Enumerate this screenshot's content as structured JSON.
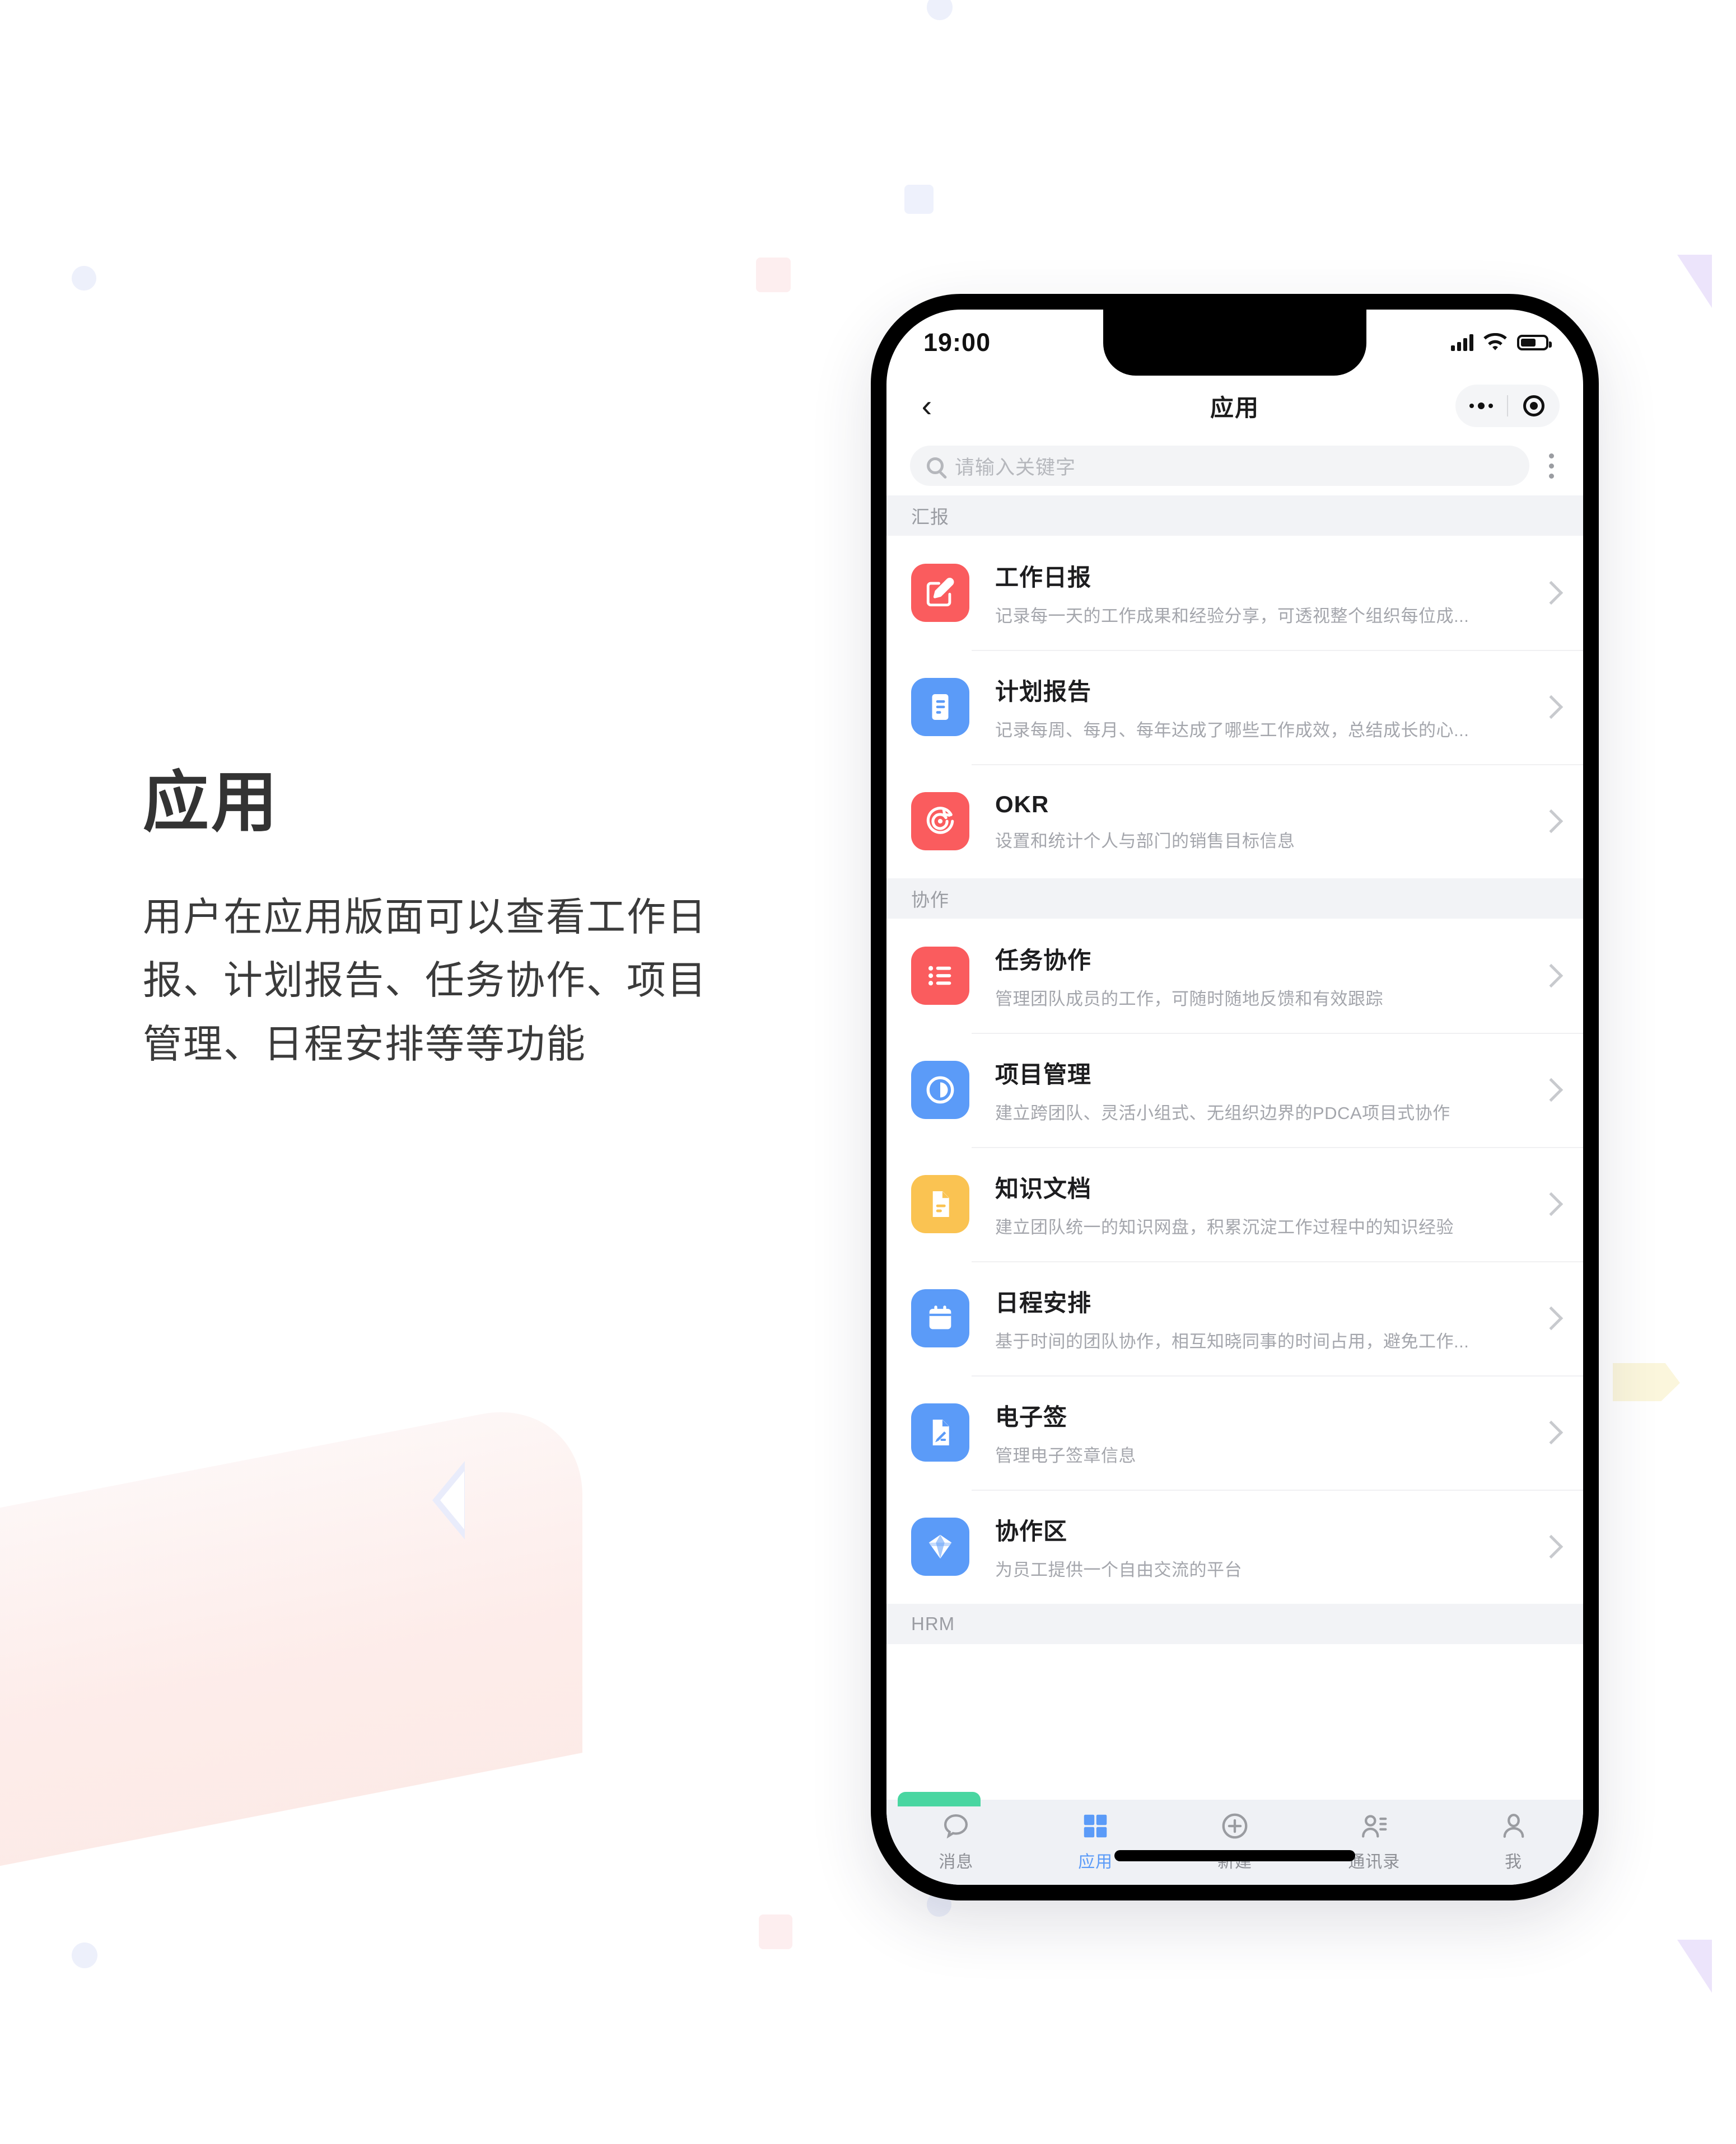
{
  "left_panel": {
    "title": "应用",
    "body": "用户在应用版面可以查看工作日报、计划报告、任务协作、项目管理、日程安排等等功能"
  },
  "phone": {
    "status_bar": {
      "time": "19:00",
      "signal_icon": "signal-bars-icon",
      "wifi_icon": "wifi-icon",
      "battery_icon": "battery-icon"
    },
    "nav": {
      "back_icon": "chevron-left-icon",
      "title": "应用",
      "more_icon": "more-dots-icon",
      "target_icon": "target-circle-icon"
    },
    "search": {
      "placeholder": "请输入关键字",
      "icon": "search-icon",
      "menu_icon": "kebab-menu-icon"
    },
    "groups": [
      {
        "header": "汇报",
        "items": [
          {
            "title": "工作日报",
            "subtitle": "记录每一天的工作成果和经验分享，可透视整个组织每位成...",
            "icon": "edit-square-icon",
            "color": "#fa5c5e"
          },
          {
            "title": "计划报告",
            "subtitle": "记录每周、每月、每年达成了哪些工作成效，总结成长的心...",
            "icon": "document-lines-icon",
            "color": "#5b9bf8"
          },
          {
            "title": "OKR",
            "subtitle": "设置和统计个人与部门的销售目标信息",
            "icon": "target-arrow-icon",
            "color": "#fa5c5e"
          }
        ]
      },
      {
        "header": "协作",
        "items": [
          {
            "title": "任务协作",
            "subtitle": "管理团队成员的工作，可随时随地反馈和有效跟踪",
            "icon": "bullet-list-icon",
            "color": "#fa5c5e"
          },
          {
            "title": "项目管理",
            "subtitle": "建立跨团队、灵活小组式、无组织边界的PDCA项目式协作",
            "icon": "pie-clock-icon",
            "color": "#5b9bf8"
          },
          {
            "title": "知识文档",
            "subtitle": "建立团队统一的知识网盘，积累沉淀工作过程中的知识经验",
            "icon": "file-text-icon",
            "color": "#fac352"
          },
          {
            "title": "日程安排",
            "subtitle": "基于时间的团队协作，相互知晓同事的时间占用，避免工作...",
            "icon": "calendar-icon",
            "color": "#5b9bf8"
          },
          {
            "title": "电子签",
            "subtitle": "管理电子签章信息",
            "icon": "file-sign-icon",
            "color": "#5b9bf8"
          },
          {
            "title": "协作区",
            "subtitle": "为员工提供一个自由交流的平台",
            "icon": "diamond-layers-icon",
            "color": "#5b9bf8"
          }
        ]
      },
      {
        "header": "HRM",
        "items": []
      }
    ],
    "tabs": [
      {
        "label": "消息",
        "icon": "chat-bubble-icon",
        "active": false
      },
      {
        "label": "应用",
        "icon": "grid-squares-icon",
        "active": true
      },
      {
        "label": "新建",
        "icon": "plus-circle-icon",
        "active": false
      },
      {
        "label": "通讯录",
        "icon": "contacts-icon",
        "active": false
      },
      {
        "label": "我",
        "icon": "person-icon",
        "active": false
      }
    ]
  },
  "colors": {
    "accent_red": "#fa5c5e",
    "accent_blue": "#5b9bf8",
    "accent_yellow": "#fac352",
    "accent_green": "#49d6a1",
    "group_header_bg": "#f2f3f6",
    "tabbar_bg": "#eff1f5"
  }
}
